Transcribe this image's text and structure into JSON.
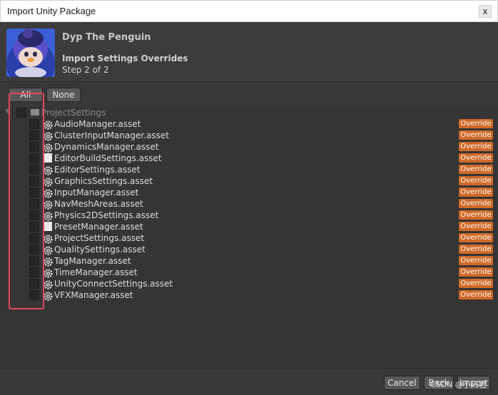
{
  "window": {
    "title": "Import Unity Package",
    "close_glyph": "x"
  },
  "header": {
    "package_name": "Dyp The Penguin",
    "step_title": "Import Settings Overrides",
    "step_subtitle": "Step 2 of 2"
  },
  "toolbar": {
    "all_label": "All",
    "none_label": "None"
  },
  "tree": {
    "root_label": "ProjectSettings",
    "items": [
      {
        "name": "AudioManager.asset",
        "icon": "gear-icon",
        "badge": "Override"
      },
      {
        "name": "ClusterInputManager.asset",
        "icon": "gear-icon",
        "badge": "Override"
      },
      {
        "name": "DynamicsManager.asset",
        "icon": "gear-icon",
        "badge": "Override"
      },
      {
        "name": "EditorBuildSettings.asset",
        "icon": "file-icon",
        "badge": "Override"
      },
      {
        "name": "EditorSettings.asset",
        "icon": "gear-icon",
        "badge": "Override"
      },
      {
        "name": "GraphicsSettings.asset",
        "icon": "gear-icon",
        "badge": "Override"
      },
      {
        "name": "InputManager.asset",
        "icon": "gear-icon",
        "badge": "Override"
      },
      {
        "name": "NavMeshAreas.asset",
        "icon": "gear-icon",
        "badge": "Override"
      },
      {
        "name": "Physics2DSettings.asset",
        "icon": "gear-icon",
        "badge": "Override"
      },
      {
        "name": "PresetManager.asset",
        "icon": "file-icon",
        "badge": "Override"
      },
      {
        "name": "ProjectSettings.asset",
        "icon": "gear-icon",
        "badge": "Override"
      },
      {
        "name": "QualitySettings.asset",
        "icon": "gear-icon",
        "badge": "Override"
      },
      {
        "name": "TagManager.asset",
        "icon": "gear-icon",
        "badge": "Override"
      },
      {
        "name": "TimeManager.asset",
        "icon": "gear-icon",
        "badge": "Override"
      },
      {
        "name": "UnityConnectSettings.asset",
        "icon": "gear-icon",
        "badge": "Override"
      },
      {
        "name": "VFXManager.asset",
        "icon": "gear-icon",
        "badge": "Override"
      }
    ]
  },
  "footer": {
    "cancel_label": "Cancel",
    "back_label": "Back",
    "import_label": "Import"
  },
  "watermark": "CSDN @小码君",
  "colors": {
    "override_badge": "#d06a28",
    "highlight_box": "#e0485a",
    "background": "#383838"
  }
}
